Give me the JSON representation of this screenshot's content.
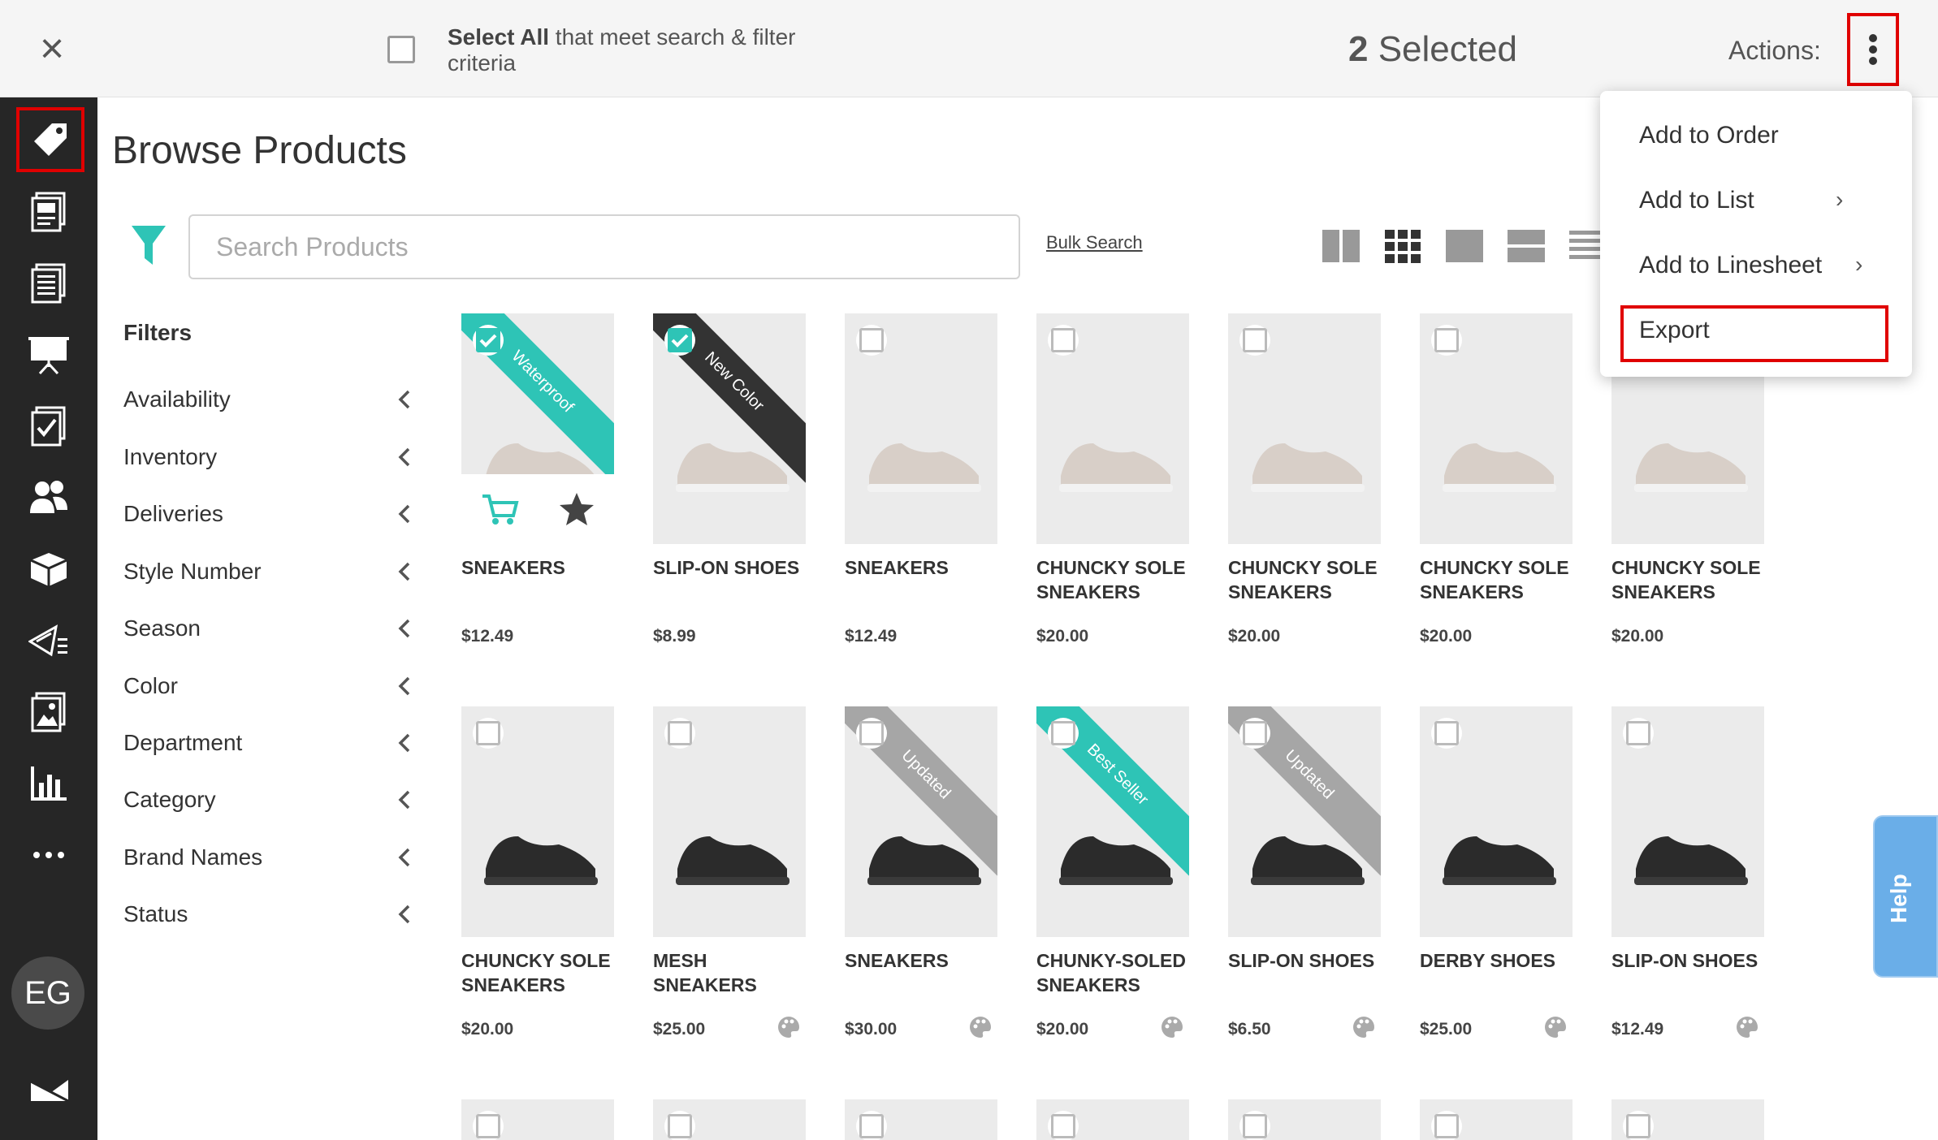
{
  "topbar": {
    "select_all_bold": "Select All",
    "select_all_rest": " that meet search & filter criteria",
    "selected_count": "2",
    "selected_label": " Selected",
    "actions_label": "Actions:"
  },
  "sidebar": {
    "active_item": "tag-icon",
    "items": [
      "tag-icon",
      "catalog-icon",
      "document-list-icon",
      "presentation-icon",
      "checklist-icon",
      "users-icon",
      "box-icon",
      "send-icon",
      "image-icon",
      "bar-chart-icon",
      "more-icon"
    ],
    "avatar_initials": "EG"
  },
  "main": {
    "title": "Browse Products",
    "search_placeholder": "Search Products",
    "bulk_search": "Bulk Search",
    "filters_heading": "Filters",
    "filters": [
      "Availability",
      "Inventory",
      "Deliveries",
      "Style Number",
      "Season",
      "Color",
      "Department",
      "Category",
      "Brand Names",
      "Status"
    ]
  },
  "colors": {
    "accent": "#2ec4b6",
    "sidebar_bg": "#262626",
    "highlight_red": "#e00000",
    "ribbon_gray": "#a6a6a6",
    "ribbon_dark": "#333333",
    "help_blue": "#6aaee8"
  },
  "products": {
    "row1": [
      {
        "name": "SNEAKERS",
        "price": "$12.49",
        "checked": true,
        "ribbon": "Waterproof",
        "ribbon_color": "teal"
      },
      {
        "name": "SLIP-ON SHOES",
        "price": "$8.99",
        "checked": true,
        "ribbon": "New Color",
        "ribbon_color": "dark"
      },
      {
        "name": "SNEAKERS",
        "price": "$12.49",
        "checked": false
      },
      {
        "name": "CHUNCKY SOLE SNEAKERS",
        "price": "$20.00",
        "checked": false
      },
      {
        "name": "CHUNCKY SOLE SNEAKERS",
        "price": "$20.00",
        "checked": false
      },
      {
        "name": "CHUNCKY SOLE SNEAKERS",
        "price": "$20.00",
        "checked": false
      },
      {
        "name": "CHUNCKY SOLE SNEAKERS",
        "price": "$20.00",
        "checked": false
      }
    ],
    "row2": [
      {
        "name": "CHUNCKY SOLE SNEAKERS",
        "price": "$20.00",
        "checked": false
      },
      {
        "name": "MESH SNEAKERS",
        "price": "$25.00",
        "checked": false
      },
      {
        "name": "SNEAKERS",
        "price": "$30.00",
        "checked": false,
        "ribbon": "Updated",
        "ribbon_color": "gray"
      },
      {
        "name": "CHUNKY-SOLED SNEAKERS",
        "price": "$20.00",
        "checked": false,
        "ribbon": "Best Seller",
        "ribbon_color": "teal"
      },
      {
        "name": "SLIP-ON SHOES",
        "price": "$6.50",
        "checked": false,
        "ribbon": "Updated",
        "ribbon_color": "gray"
      },
      {
        "name": "DERBY SHOES",
        "price": "$25.00",
        "checked": false
      },
      {
        "name": "SLIP-ON SHOES",
        "price": "$12.49",
        "checked": false
      }
    ]
  },
  "dropdown": {
    "items": [
      "Add to Order",
      "Add to List",
      "Add to Linesheet",
      "Export"
    ],
    "highlighted": "Export"
  },
  "help": {
    "label": "Help"
  }
}
